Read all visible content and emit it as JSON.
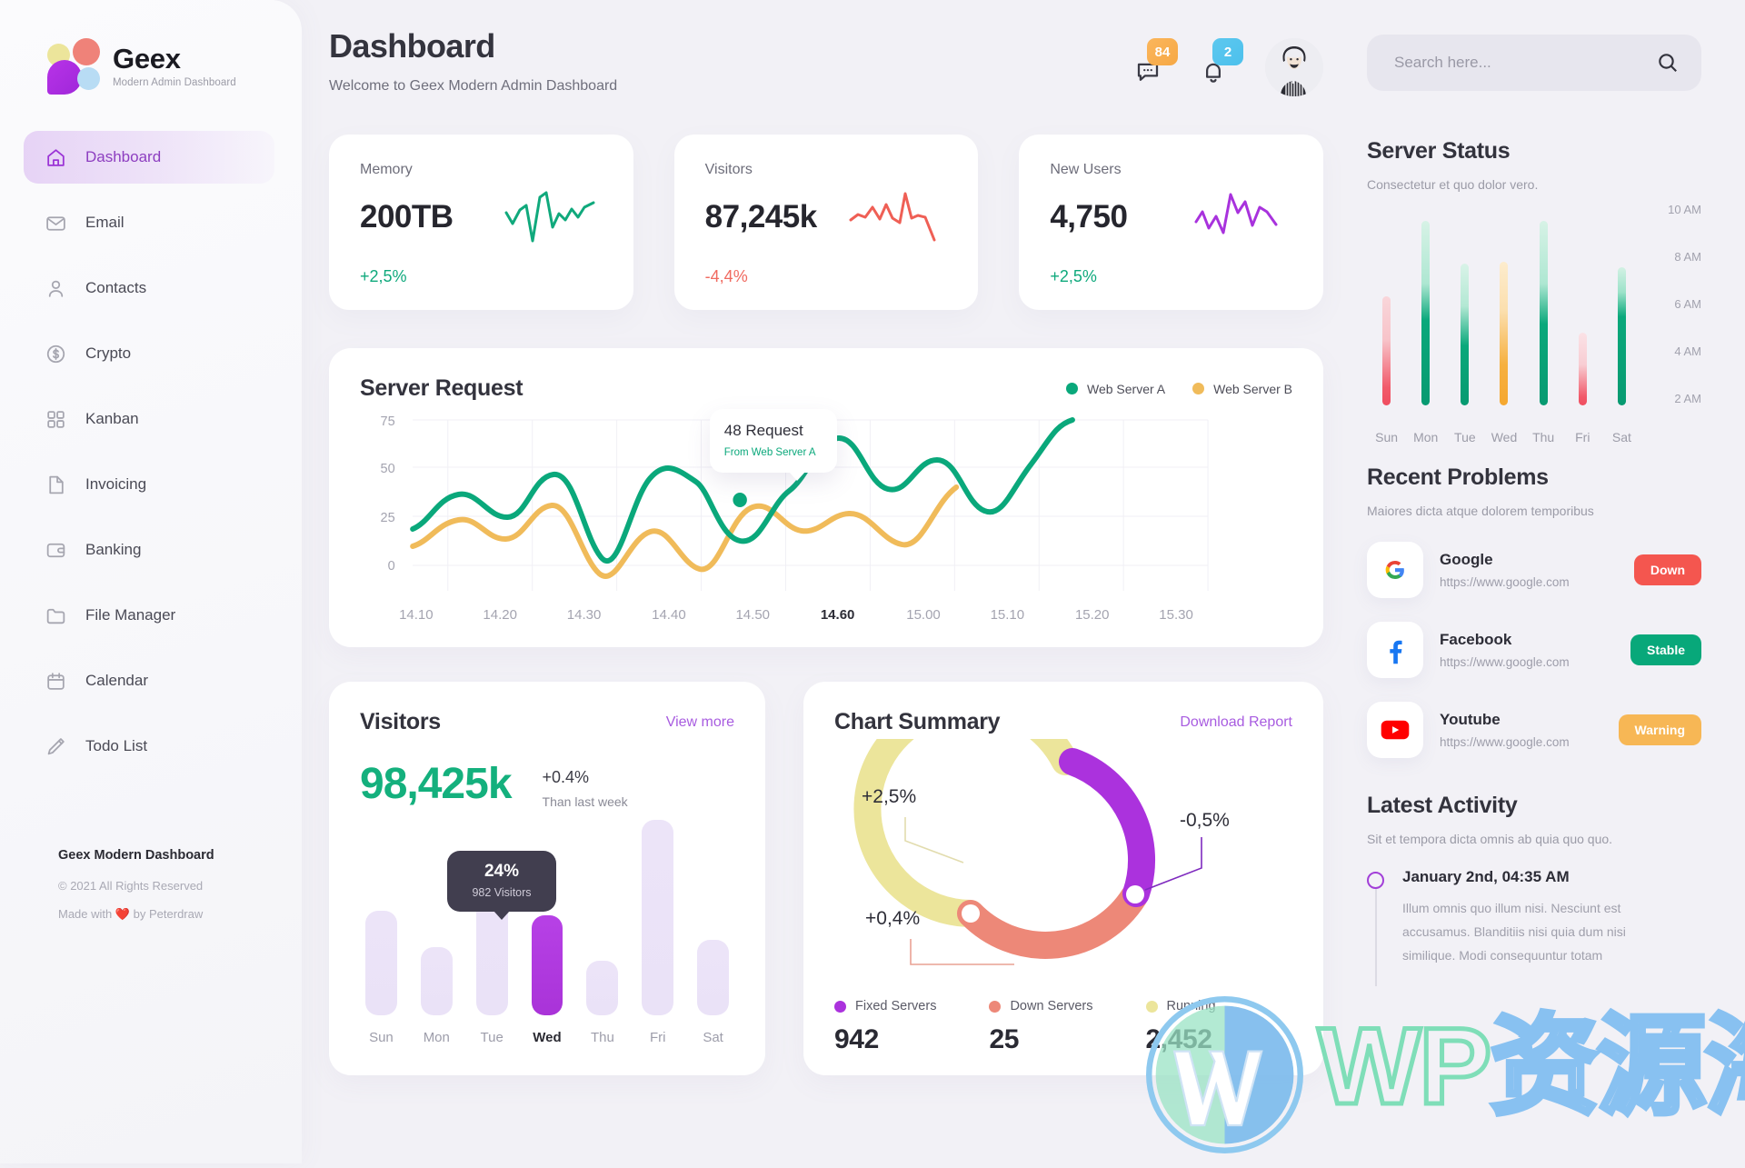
{
  "brand": {
    "name": "Geex",
    "tagline": "Modern Admin Dashboard",
    "logo_icon": "geex-logo-icon"
  },
  "sidebar": {
    "items": [
      {
        "label": "Dashboard",
        "icon": "home-icon",
        "active": true
      },
      {
        "label": "Email",
        "icon": "envelope-icon",
        "active": false
      },
      {
        "label": "Contacts",
        "icon": "user-icon",
        "active": false
      },
      {
        "label": "Crypto",
        "icon": "dollar-circle-icon",
        "active": false
      },
      {
        "label": "Kanban",
        "icon": "grid-icon",
        "active": false
      },
      {
        "label": "Invoicing",
        "icon": "file-icon",
        "active": false
      },
      {
        "label": "Banking",
        "icon": "wallet-icon",
        "active": false
      },
      {
        "label": "File Manager",
        "icon": "folder-icon",
        "active": false
      },
      {
        "label": "Calendar",
        "icon": "calendar-icon",
        "active": false
      },
      {
        "label": "Todo List",
        "icon": "pencil-icon",
        "active": false
      }
    ],
    "footer": {
      "title": "Geex Modern Dashboard",
      "copyright": "© 2021 All Rights Reserved",
      "credit": "Made with ❤️ by Peterdraw"
    }
  },
  "header": {
    "title": "Dashboard",
    "subtitle": "Welcome to Geex Modern Admin Dashboard",
    "chat_icon": "chat-bubble-icon",
    "chat_badge": "84",
    "bell_icon": "bell-icon",
    "bell_badge": "2",
    "avatar_name": "avatar"
  },
  "search": {
    "placeholder": "Search here...",
    "value": "",
    "icon": "search-icon"
  },
  "stats": [
    {
      "label": "Memory",
      "value": "200TB",
      "delta": "+2,5%",
      "dir": "up",
      "color": "#10a97c"
    },
    {
      "label": "Visitors",
      "value": "87,245k",
      "delta": "-4,4%",
      "dir": "down",
      "color": "#ef5f55"
    },
    {
      "label": "New Users",
      "value": "4,750",
      "delta": "+2,5%",
      "dir": "up",
      "color": "#a832dd"
    }
  ],
  "server_request": {
    "title": "Server Request",
    "legend": [
      {
        "label": "Web Server A",
        "color": "#0aa87b"
      },
      {
        "label": "Web Server B",
        "color": "#f0bb5a"
      }
    ],
    "tooltip": {
      "value": "48 Request",
      "source": "From Web Server A"
    }
  },
  "visitors": {
    "title": "Visitors",
    "link": "View more",
    "total": "98,425k",
    "delta": "+0.4%",
    "delta_note": "Than last week",
    "tooltip": {
      "percent": "24%",
      "detail": "982 Visitors"
    }
  },
  "chart_summary": {
    "title": "Chart Summary",
    "link": "Download Report",
    "callouts": [
      "+2,5%",
      "-0,5%",
      "+0,4%"
    ],
    "legend": [
      {
        "label": "Fixed Servers",
        "value": "942",
        "color": "#ab32dd"
      },
      {
        "label": "Down Servers",
        "value": "25",
        "color": "#ed8878"
      },
      {
        "label": "Running",
        "value": "2,452",
        "color": "#ece59b"
      }
    ]
  },
  "server_status": {
    "title": "Server Status",
    "subtitle": "Consectetur et quo dolor vero."
  },
  "recent_problems": {
    "title": "Recent Problems",
    "subtitle": "Maiores dicta atque dolorem temporibus",
    "items": [
      {
        "name": "Google",
        "url": "https://www.google.com",
        "status": "Down",
        "status_color": "#f4564f",
        "icon": "google-icon"
      },
      {
        "name": "Facebook",
        "url": "https://www.google.com",
        "status": "Stable",
        "status_color": "#08a87a",
        "icon": "facebook-icon"
      },
      {
        "name": "Youtube",
        "url": "https://www.google.com",
        "status": "Warning",
        "status_color": "#f7b755",
        "icon": "youtube-icon"
      }
    ]
  },
  "latest_activity": {
    "title": "Latest Activity",
    "subtitle": "Sit et tempora dicta omnis ab quia quo quo.",
    "entry_time": "January 2nd, 04:35 AM",
    "entry_body": "Illum omnis quo illum nisi. Nesciunt est accusamus. Blanditiis nisi quia dum nisi similique. Modi consequuntur totam"
  },
  "watermark": {
    "text_latin": "WP",
    "text_cjk": "资源海",
    "icon": "wordpress-icon"
  },
  "chart_data": [
    {
      "type": "line",
      "title": "Server Request",
      "x": [
        "14.10",
        "14.20",
        "14.30",
        "14.40",
        "14.50",
        "14.60",
        "15.00",
        "15.10",
        "15.20",
        "15.30"
      ],
      "xlabel": "",
      "ylabel": "",
      "ylim": [
        0,
        80
      ],
      "yticks": [
        0,
        25,
        50,
        75
      ],
      "grid": true,
      "legend_position": "top-right",
      "highlight_x": "14.60",
      "annotation": "48 Request / From Web Server A",
      "series": [
        {
          "name": "Web Server A",
          "color": "#0aa87b",
          "values": [
            17,
            37,
            27,
            47,
            30,
            6,
            62,
            48,
            41,
            24,
            67,
            45,
            50,
            31,
            80
          ]
        },
        {
          "name": "Web Server B",
          "color": "#f0bb5a",
          "values": [
            10,
            24,
            16,
            31,
            21,
            -3,
            20,
            28,
            18,
            7,
            46,
            28,
            33,
            17,
            54
          ]
        }
      ]
    },
    {
      "type": "bar",
      "title": "Visitors",
      "categories": [
        "Sun",
        "Mon",
        "Tue",
        "Wed",
        "Thu",
        "Fri",
        "Sat"
      ],
      "values": [
        46,
        30,
        72,
        44,
        24,
        86,
        33
      ],
      "highlight_category": "Wed",
      "highlight_value_label": "24%",
      "highlight_detail": "982 Visitors",
      "ylabel": "",
      "xlabel": "",
      "grid": false
    },
    {
      "type": "pie",
      "title": "Chart Summary",
      "labels": [
        "Fixed Servers",
        "Down Servers",
        "Running"
      ],
      "values": [
        942,
        25,
        2452
      ],
      "share_percent": [
        38,
        28,
        34
      ],
      "colors": [
        "#ab32dd",
        "#ed8878",
        "#ece59b"
      ],
      "callouts": [
        "-0,5%",
        "+0,4%",
        "+2,5%"
      ],
      "donut": true
    },
    {
      "type": "bar",
      "title": "Server Status",
      "categories": [
        "Sun",
        "Mon",
        "Tue",
        "Wed",
        "Thu",
        "Fri",
        "Sat"
      ],
      "values": [
        6.4,
        10.2,
        8.0,
        8.1,
        10.2,
        4.4,
        7.9
      ],
      "filled_values": [
        2.6,
        5.3,
        5.4,
        3.7,
        5.3,
        2.1,
        6.0
      ],
      "yticks": [
        "2 AM",
        "4 AM",
        "6 AM",
        "8 AM",
        "10 AM"
      ],
      "ylim": [
        1.5,
        10.5
      ],
      "colors": [
        "#f2596a",
        "#0aa87b",
        "#0aa87b",
        "#f6b03f",
        "#0aa87b",
        "#f2596a",
        "#0aa87b"
      ],
      "grid": false
    }
  ]
}
